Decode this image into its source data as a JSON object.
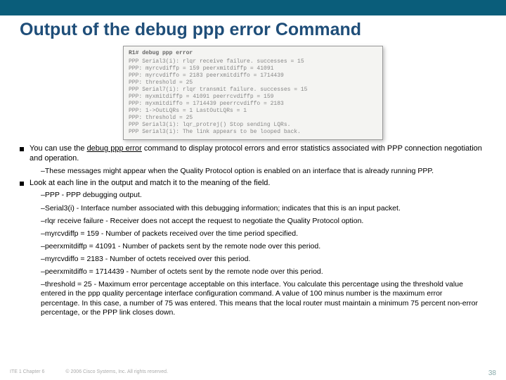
{
  "title": "Output of the debug ppp error Command",
  "terminal": {
    "header": "R1# debug ppp error",
    "lines": [
      "PPP Serial3(i): rlqr receive failure. successes = 15",
      "PPP: myrcvdiffp = 159 peerxmitdiffp = 41091",
      "PPP: myrcvdiffo = 2183 peerxmitdiffo = 1714439",
      "PPP: threshold = 25",
      "PPP Serial7(i): rlqr transmit failure. successes = 15",
      "PPP: myxmitdiffp = 41091 peerrcvdiffp = 159",
      "PPP: myxmitdiffo = 1714439 peerrcvdiffo = 2183",
      "PPP: 1->OutLQRs = 1 LastOutLQRs = 1",
      "PPP: threshold = 25",
      "PPP Serial3(i): lqr_protrej() Stop sending LQRs.",
      "PPP Serial3(i): The link appears to be looped back."
    ]
  },
  "bullets": [
    {
      "pre": "You can use the ",
      "cmd": "debug ppp error",
      "post": " command to display protocol errors and error statistics associated with PPP connection negotiation and operation.",
      "subs": [
        "–These messages might appear when the Quality Protocol option is enabled on an interface that is already running PPP."
      ]
    },
    {
      "pre": "Look at each line in the output and match it to the meaning of the field.",
      "cmd": "",
      "post": "",
      "subs": [
        "–PPP - PPP debugging output.",
        "–Serial3(i) - Interface number associated with this debugging information; indicates that this is an input packet.",
        "–rlqr receive failure - Receiver does not accept the request to negotiate the Quality Protocol option.",
        "–myrcvdiffp = 159 - Number of packets received over the time period specified.",
        "–peerxmitdiffp = 41091 - Number of packets sent by the remote node over this period.",
        "–myrcvdiffo = 2183 - Number of octets received over this period.",
        "–peerxmitdiffo = 1714439 - Number of octets sent by the remote node over this period.",
        "–threshold = 25 - Maximum error percentage acceptable on this interface. You calculate this percentage using the threshold value entered in the ppp quality percentage interface configuration command. A value of 100 minus number is the maximum error percentage. In this case, a number of 75 was entered. This means that the local router must maintain a minimum 75 percent non-error percentage, or the PPP link closes down."
      ]
    }
  ],
  "footer": {
    "left": "ITE 1 Chapter 6",
    "mid": "© 2006 Cisco Systems, Inc. All rights reserved.",
    "page": "38"
  }
}
